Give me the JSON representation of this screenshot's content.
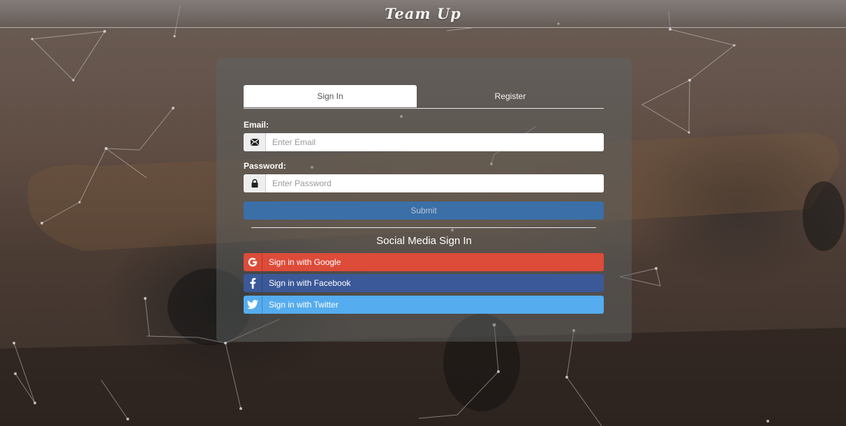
{
  "header": {
    "brand": "Team Up"
  },
  "tabs": [
    {
      "label": "Sign In",
      "active": true
    },
    {
      "label": "Register",
      "active": false
    }
  ],
  "form": {
    "email": {
      "label": "Email:",
      "placeholder": "Enter Email",
      "value": "",
      "icon": "envelope-icon"
    },
    "password": {
      "label": "Password:",
      "placeholder": "Enter Password",
      "value": "",
      "icon": "lock-icon"
    },
    "submit_label": "Submit"
  },
  "social": {
    "title": "Social Media Sign In",
    "buttons": [
      {
        "label": "Sign in with Google",
        "icon": "google-icon",
        "color": "#dd4b39"
      },
      {
        "label": "Sign in with Facebook",
        "icon": "facebook-icon",
        "color": "#3b5998"
      },
      {
        "label": "Sign in with Twitter",
        "icon": "twitter-icon",
        "color": "#55acee"
      }
    ]
  },
  "colors": {
    "submit": "#3a6fa8",
    "card_overlay": "rgba(95,100,100,0.48)"
  }
}
